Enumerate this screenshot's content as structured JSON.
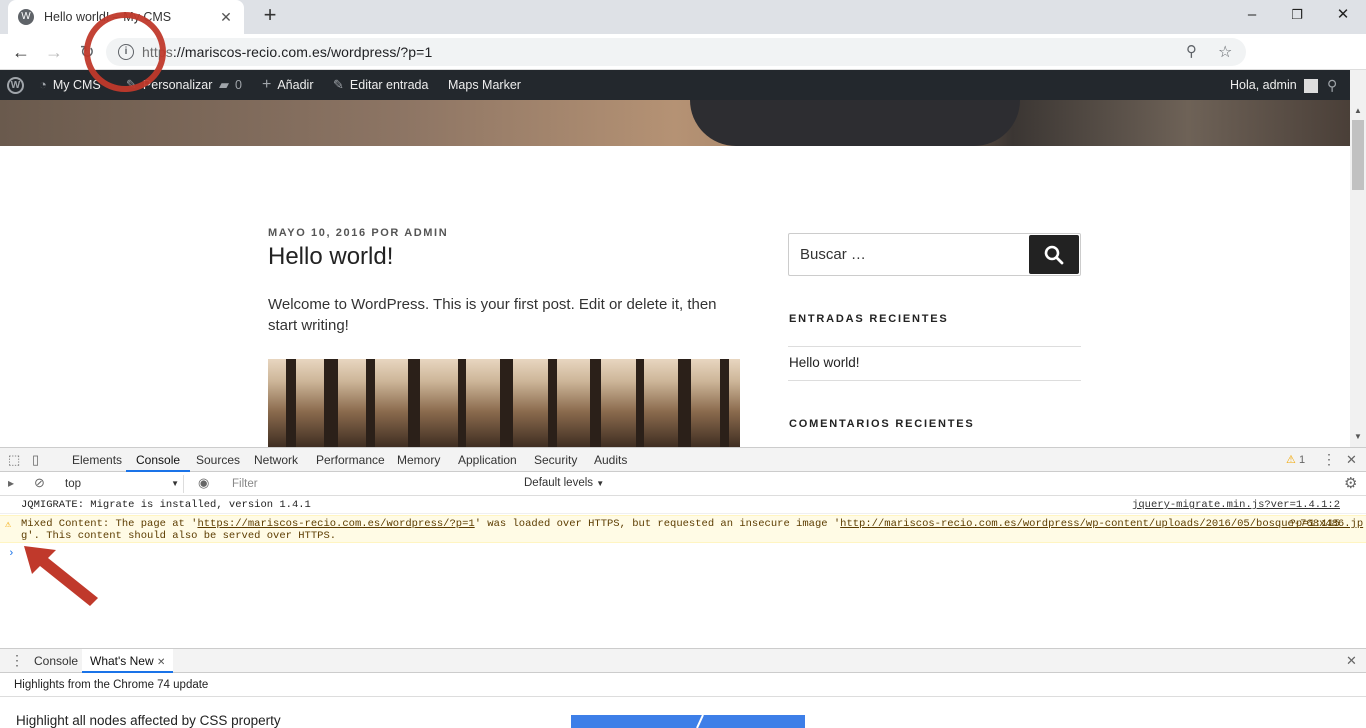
{
  "browser": {
    "tab_title": "Hello world! – My CMS",
    "url_scheme": "https",
    "url_rest": "://mariscos-recio.com.es/wordpress/?p=1",
    "new_tab": "+",
    "min": "–",
    "max": "❐",
    "close": "✕"
  },
  "adminbar": {
    "site": "My CMS",
    "customize": "Personalizar",
    "comments": "0",
    "add": "Añadir",
    "edit": "Editar entrada",
    "maps": "Maps Marker",
    "greeting": "Hola, admin"
  },
  "post": {
    "meta": "MAYO 10, 2016 POR ADMIN",
    "title": "Hello world!",
    "excerpt": "Welcome to WordPress. This is your first post. Edit or delete it, then start writing!"
  },
  "sidebar": {
    "search_placeholder": "Buscar …",
    "recent_posts_title": "ENTRADAS RECIENTES",
    "recent_posts": [
      "Hello world!"
    ],
    "recent_comments_title": "COMENTARIOS RECIENTES"
  },
  "devtools": {
    "tabs": [
      "Elements",
      "Console",
      "Sources",
      "Network",
      "Performance",
      "Memory",
      "Application",
      "Security",
      "Audits"
    ],
    "active_tab": "Console",
    "warning_count": "1",
    "context": "top",
    "filter_placeholder": "Filter",
    "levels": "Default levels",
    "log": [
      {
        "level": "info",
        "message": "JQMIGRATE: Migrate is installed, version 1.4.1",
        "source": "jquery-migrate.min.js?ver=1.4.1:2"
      },
      {
        "level": "warning",
        "line1_prefix": "Mixed Content: The page at '",
        "page_url": "https://mariscos-recio.com.es/wordpress/?p=1",
        "line1_mid": "' was loaded over HTTPS, but requested an insecure image '",
        "image_url": "http://mariscos-recio.com.es/wordpress/wp-content/uploads/2016/05/bosque-768x486.jp",
        "line2": "g'. This content should also be served over HTTPS.",
        "source": "?p=1:115"
      }
    ],
    "drawer_tabs": [
      "Console",
      "What's New"
    ],
    "drawer_active": "What's New",
    "drawer_subtitle": "Highlights from the Chrome 74 update",
    "highlight_text": "Highlight all nodes affected by CSS property"
  },
  "colors": {
    "annotation_red": "#c0392b",
    "admin_bar": "#23282d",
    "devtools_blue": "#1a73e8"
  }
}
